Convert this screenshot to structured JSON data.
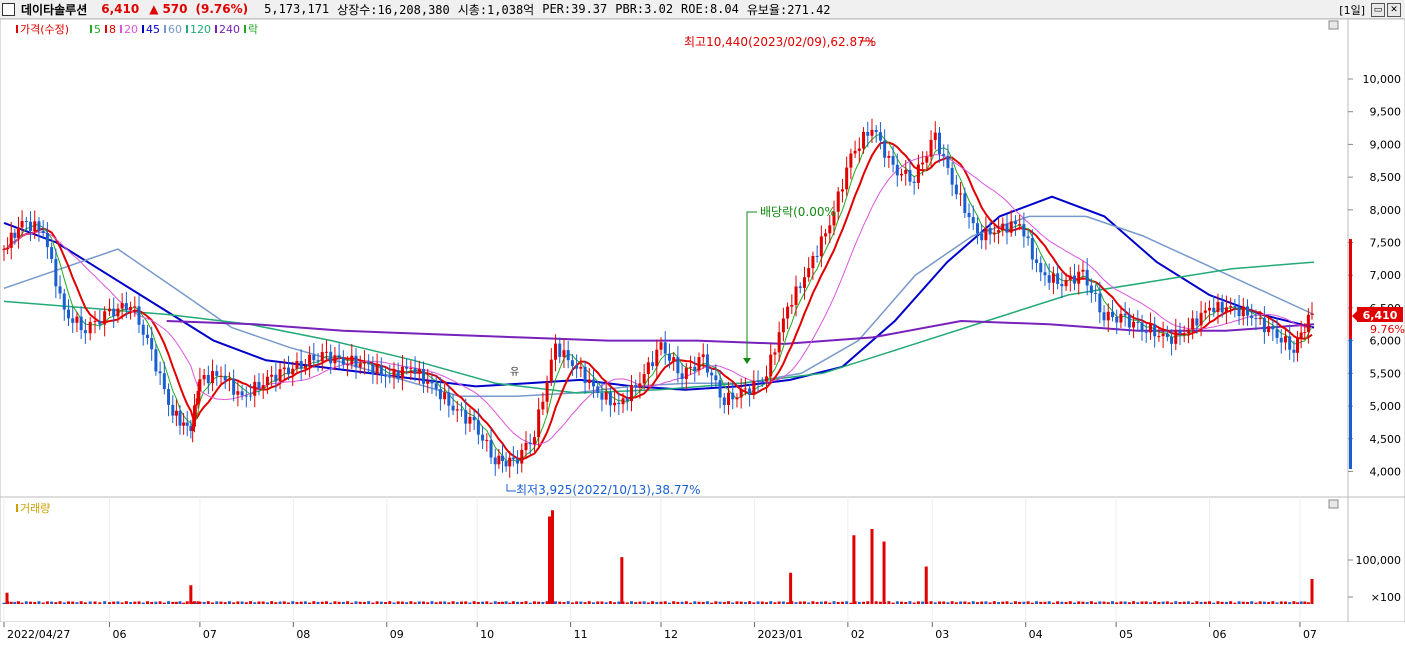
{
  "header": {
    "name": "데이타솔루션",
    "price": "6,410",
    "up_symbol": "▲",
    "change": "570",
    "change_pct": "(9.76%)",
    "volume": "5,173,171",
    "listed_shares": "상장수:16,208,380",
    "market_cap": "시총:1,038억",
    "per": "PER:39.37",
    "pbr": "PBR:3.02",
    "roe": "ROE:8.04",
    "float_ratio": "유보율:271.42",
    "period": "[1일]"
  },
  "legend": {
    "items": [
      {
        "label": "가격(수정)",
        "color": "#e00000"
      },
      {
        "label": "5",
        "color": "#22aa22"
      },
      {
        "label": "8",
        "color": "#e00000"
      },
      {
        "label": "20",
        "color": "#dd55dd"
      },
      {
        "label": "45",
        "color": "#0000cc"
      },
      {
        "label": "60",
        "color": "#7799cc"
      },
      {
        "label": "120",
        "color": "#22aa77"
      },
      {
        "label": "240",
        "color": "#7722bb"
      },
      {
        "label": "락",
        "color": "#22aa22"
      }
    ]
  },
  "volume_legend": {
    "label": "거래량",
    "color": "#c8a000"
  },
  "annotations": {
    "high": "최고10,440(2023/02/09),62.87%",
    "low": "최저3,925(2022/10/13),38.77%",
    "dividend": "배당락(0.00%",
    "small_mark": "유"
  },
  "price_tag": {
    "value": "6,410",
    "pct": "9.76%"
  },
  "colors": {
    "up": "#e00000",
    "down": "#1a5fd0",
    "ma5": "#22aa22",
    "ma8": "#e00000",
    "ma20": "#dd55dd",
    "ma45": "#0000cc",
    "ma60": "#7799cc",
    "ma120": "#22aa77",
    "ma240": "#7722bb"
  },
  "chart_data": [
    {
      "type": "candlestick",
      "title": "데이타솔루션 (일봉)",
      "x_ticks": [
        "2022/04/27",
        "06",
        "07",
        "08",
        "09",
        "10",
        "11",
        "12",
        "2023/01",
        "02",
        "03",
        "04",
        "05",
        "06",
        "07"
      ],
      "y_ticks": [
        "4,000",
        "4,500",
        "5,000",
        "5,500",
        "6,000",
        "6,500",
        "7,000",
        "7,500",
        "8,000",
        "8,500",
        "9,000",
        "9,500",
        "10,000"
      ],
      "ylim": [
        3750,
        10900
      ],
      "close_series": [
        [
          "2022/04/27",
          7400
        ],
        [
          "2022/05/03",
          7800
        ],
        [
          "2022/05/10",
          7700
        ],
        [
          "2022/05/17",
          6400
        ],
        [
          "2022/05/24",
          6200
        ],
        [
          "2022/06/01",
          6400
        ],
        [
          "2022/06/08",
          6600
        ],
        [
          "2022/06/15",
          5800
        ],
        [
          "2022/06/22",
          4900
        ],
        [
          "2022/06/28",
          4600
        ],
        [
          "2022/07/01",
          5400
        ],
        [
          "2022/07/08",
          5500
        ],
        [
          "2022/07/15",
          5100
        ],
        [
          "2022/07/22",
          5400
        ],
        [
          "2022/07/29",
          5500
        ],
        [
          "2022/08/05",
          5700
        ],
        [
          "2022/08/12",
          5750
        ],
        [
          "2022/08/19",
          5700
        ],
        [
          "2022/08/26",
          5600
        ],
        [
          "2022/09/02",
          5450
        ],
        [
          "2022/09/09",
          5600
        ],
        [
          "2022/09/16",
          5300
        ],
        [
          "2022/09/23",
          5000
        ],
        [
          "2022/09/30",
          4700
        ],
        [
          "2022/10/07",
          4200
        ],
        [
          "2022/10/13",
          4100
        ],
        [
          "2022/10/20",
          4600
        ],
        [
          "2022/10/27",
          5900
        ],
        [
          "2022/11/03",
          5600
        ],
        [
          "2022/11/10",
          5200
        ],
        [
          "2022/11/17",
          5000
        ],
        [
          "2022/11/24",
          5400
        ],
        [
          "2022/12/01",
          5900
        ],
        [
          "2022/12/08",
          5500
        ],
        [
          "2022/12/15",
          5700
        ],
        [
          "2022/12/22",
          5100
        ],
        [
          "2022/12/29",
          5200
        ],
        [
          "2023/01/05",
          5500
        ],
        [
          "2023/01/12",
          6500
        ],
        [
          "2023/01/19",
          7100
        ],
        [
          "2023/01/26",
          7800
        ],
        [
          "2023/02/02",
          8800
        ],
        [
          "2023/02/09",
          9300
        ],
        [
          "2023/02/16",
          8600
        ],
        [
          "2023/02/23",
          8500
        ],
        [
          "2023/03/02",
          9100
        ],
        [
          "2023/03/09",
          8300
        ],
        [
          "2023/03/16",
          7600
        ],
        [
          "2023/03/23",
          7700
        ],
        [
          "2023/03/30",
          7800
        ],
        [
          "2023/04/06",
          7000
        ],
        [
          "2023/04/13",
          6900
        ],
        [
          "2023/04/20",
          7000
        ],
        [
          "2023/04/27",
          6400
        ],
        [
          "2023/05/04",
          6300
        ],
        [
          "2023/05/11",
          6200
        ],
        [
          "2023/05/18",
          6000
        ],
        [
          "2023/05/25",
          6200
        ],
        [
          "2023/06/01",
          6500
        ],
        [
          "2023/06/08",
          6500
        ],
        [
          "2023/06/15",
          6400
        ],
        [
          "2023/06/22",
          6100
        ],
        [
          "2023/06/29",
          5900
        ],
        [
          "2023/07/05",
          6410
        ]
      ],
      "ma_series": [
        {
          "name": "45",
          "values": [
            7800,
            7500,
            7000,
            6500,
            6000,
            5700,
            5600,
            5500,
            5400,
            5300,
            5350,
            5400,
            5300,
            5250,
            5300,
            5400,
            5600,
            6300,
            7200,
            7900,
            8200,
            7900,
            7200,
            6700,
            6400,
            6200
          ]
        },
        {
          "name": "60",
          "values": [
            6800,
            7100,
            7400,
            6800,
            6200,
            5900,
            5650,
            5400,
            5150,
            5150,
            5200,
            5300,
            5350,
            5350,
            5500,
            6000,
            7000,
            7600,
            7900,
            7900,
            7600,
            7200,
            6800,
            6400
          ]
        },
        {
          "name": "120",
          "values": [
            6600,
            6500,
            6400,
            6250,
            6000,
            5700,
            5350,
            5200,
            5250,
            5350,
            5500,
            5900,
            6300,
            6700,
            6900,
            7100,
            7200
          ]
        },
        {
          "name": "240",
          "values": [
            6300,
            6250,
            6150,
            6100,
            6050,
            6000,
            6000,
            5950,
            6050,
            6300,
            6250,
            6150,
            6150,
            6250
          ]
        }
      ]
    },
    {
      "type": "bar",
      "title": "거래량",
      "y_ticks": [
        "100,000",
        "×100"
      ],
      "volume_spikes": [
        {
          "x": "2022/04/28",
          "value": 18000
        },
        {
          "x": "2022/06/28",
          "value": 30000
        },
        {
          "x": "2022/10/25",
          "value": 140000
        },
        {
          "x": "2022/10/26",
          "value": 150000
        },
        {
          "x": "2022/11/18",
          "value": 75000
        },
        {
          "x": "2023/01/13",
          "value": 50000
        },
        {
          "x": "2023/02/03",
          "value": 110000
        },
        {
          "x": "2023/02/09",
          "value": 120000
        },
        {
          "x": "2023/02/13",
          "value": 100000
        },
        {
          "x": "2023/02/27",
          "value": 60000
        },
        {
          "x": "2023/07/05",
          "value": 40000
        }
      ]
    }
  ]
}
